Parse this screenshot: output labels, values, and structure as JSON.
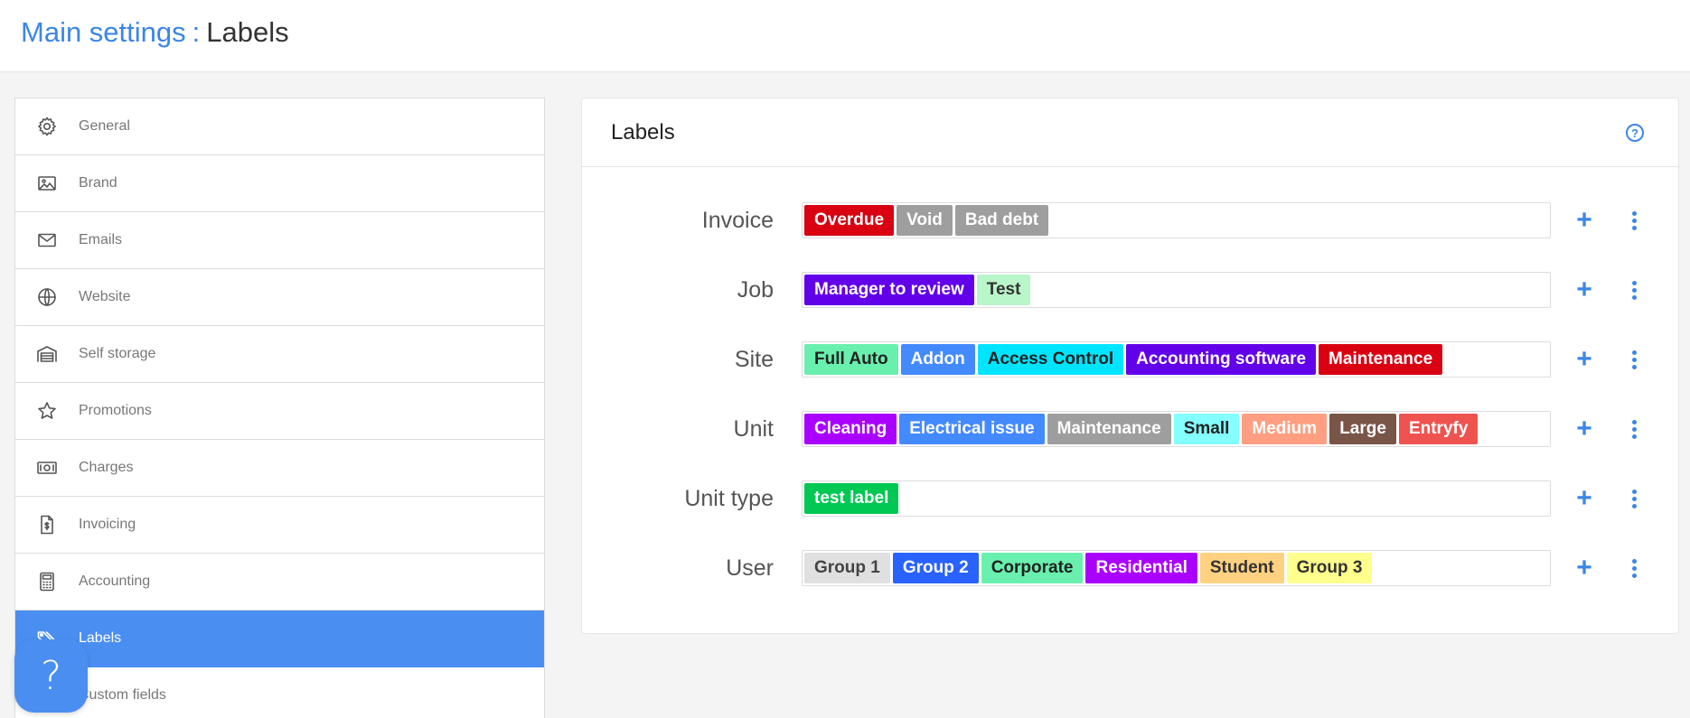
{
  "breadcrumb": {
    "parent": "Main settings",
    "separator": ":",
    "current": "Labels"
  },
  "sidebar": {
    "items": [
      {
        "label": "General",
        "icon": "gear-icon",
        "active": false
      },
      {
        "label": "Brand",
        "icon": "image-icon",
        "active": false
      },
      {
        "label": "Emails",
        "icon": "envelope-icon",
        "active": false
      },
      {
        "label": "Website",
        "icon": "globe-icon",
        "active": false
      },
      {
        "label": "Self storage",
        "icon": "garage-icon",
        "active": false
      },
      {
        "label": "Promotions",
        "icon": "star-icon",
        "active": false
      },
      {
        "label": "Charges",
        "icon": "banknote-icon",
        "active": false
      },
      {
        "label": "Invoicing",
        "icon": "invoice-icon",
        "active": false
      },
      {
        "label": "Accounting",
        "icon": "calculator-icon",
        "active": false
      },
      {
        "label": "Labels",
        "icon": "tags-icon",
        "active": true
      },
      {
        "label": "Custom fields",
        "icon": "custom-fields-icon",
        "active": false
      }
    ]
  },
  "help_fab": {
    "label": "?"
  },
  "card": {
    "title": "Labels",
    "help_label": "?"
  },
  "label_groups": [
    {
      "name": "Invoice",
      "tags": [
        {
          "text": "Overdue",
          "bg": "#d90012",
          "fg": "#ffffff"
        },
        {
          "text": "Void",
          "bg": "#9e9e9e",
          "fg": "#ffffff"
        },
        {
          "text": "Bad debt",
          "bg": "#9e9e9e",
          "fg": "#ffffff"
        }
      ]
    },
    {
      "name": "Job",
      "tags": [
        {
          "text": "Manager to review",
          "bg": "#6200ea",
          "fg": "#ffffff"
        },
        {
          "text": "Test",
          "bg": "#b9f6ca",
          "fg": "#333333"
        }
      ]
    },
    {
      "name": "Site",
      "tags": [
        {
          "text": "Full Auto",
          "bg": "#69f0ae",
          "fg": "#222222"
        },
        {
          "text": "Addon",
          "bg": "#448aff",
          "fg": "#ffffff"
        },
        {
          "text": "Access Control",
          "bg": "#00e5ff",
          "fg": "#222222"
        },
        {
          "text": "Accounting software",
          "bg": "#6200ea",
          "fg": "#ffffff"
        },
        {
          "text": "Maintenance",
          "bg": "#d90012",
          "fg": "#ffffff"
        }
      ]
    },
    {
      "name": "Unit",
      "tags": [
        {
          "text": "Cleaning",
          "bg": "#aa00ff",
          "fg": "#ffffff"
        },
        {
          "text": "Electrical issue",
          "bg": "#448aff",
          "fg": "#ffffff"
        },
        {
          "text": "Maintenance",
          "bg": "#9e9e9e",
          "fg": "#ffffff"
        },
        {
          "text": "Small",
          "bg": "#84ffff",
          "fg": "#222222"
        },
        {
          "text": "Medium",
          "bg": "#ff9e80",
          "fg": "#ffffff"
        },
        {
          "text": "Large",
          "bg": "#795548",
          "fg": "#ffffff"
        },
        {
          "text": "Entryfy",
          "bg": "#ef5350",
          "fg": "#ffffff"
        }
      ]
    },
    {
      "name": "Unit type",
      "tags": [
        {
          "text": "test label",
          "bg": "#00c853",
          "fg": "#ffffff"
        }
      ]
    },
    {
      "name": "User",
      "tags": [
        {
          "text": "Group 1",
          "bg": "#e0e0e0",
          "fg": "#444444"
        },
        {
          "text": "Group 2",
          "bg": "#2962ff",
          "fg": "#ffffff"
        },
        {
          "text": "Corporate",
          "bg": "#69f0ae",
          "fg": "#222222"
        },
        {
          "text": "Residential",
          "bg": "#aa00ff",
          "fg": "#ffffff"
        },
        {
          "text": "Student",
          "bg": "#ffd180",
          "fg": "#333333"
        },
        {
          "text": "Group 3",
          "bg": "#ffff8d",
          "fg": "#333333"
        }
      ]
    }
  ],
  "row_actions": {
    "add_label": "+"
  },
  "colors": {
    "accent": "#3b86e6",
    "active_nav": "#4b8ef1"
  }
}
